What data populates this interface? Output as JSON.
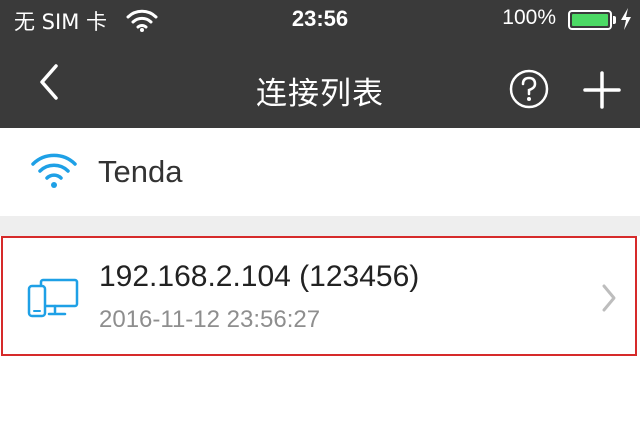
{
  "status_bar": {
    "carrier": "无 SIM 卡",
    "time": "23:56",
    "battery_percent": "100%",
    "battery_level": 1.0,
    "icons": [
      "wifi-signal-icon",
      "battery-icon",
      "charging-bolt-icon"
    ]
  },
  "nav": {
    "title": "连接列表",
    "icons": [
      "back-chevron-icon",
      "help-question-icon",
      "add-plus-icon"
    ]
  },
  "wifi_network": {
    "name": "Tenda",
    "icon": "wifi-icon"
  },
  "connections": [
    {
      "ip": "192.168.2.104 (123456)",
      "timestamp": "2016-11-12 23:56:27",
      "icon": "devices-icon",
      "selected": true
    }
  ],
  "colors": {
    "header_bg": "#3a3a3a",
    "accent_blue": "#1ea0e6",
    "battery_green": "#4cd964",
    "selection_border": "#d62a2a",
    "separator": "#eeeeee"
  }
}
